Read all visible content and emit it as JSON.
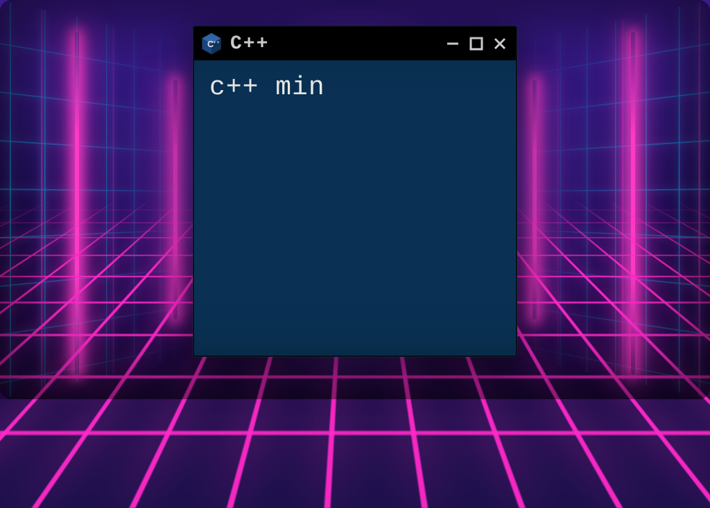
{
  "window": {
    "title": "C++",
    "icon_name": "cpp-hex-icon"
  },
  "terminal": {
    "line1": "c++ min"
  },
  "colors": {
    "terminal_bg": "#0a3153",
    "titlebar_bg": "#000000",
    "text": "#e8e8e8",
    "neon_magenta": "#ff28c8",
    "neon_cyan": "#00c8ff"
  }
}
